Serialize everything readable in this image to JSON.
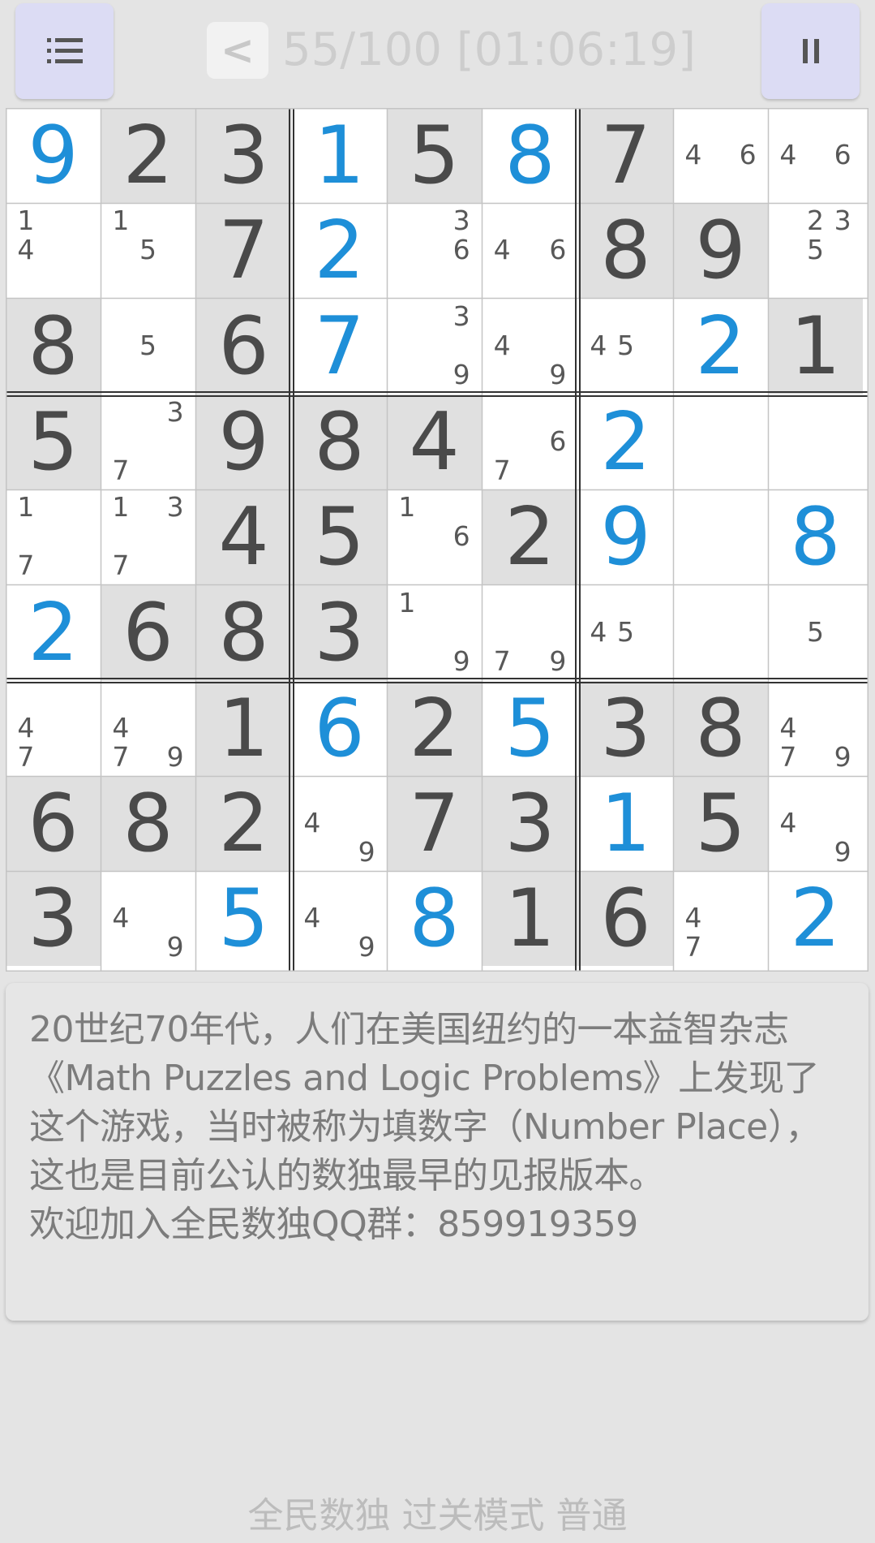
{
  "header": {
    "progress": "55/100",
    "timer": "[01:06:19]",
    "back_label": "<",
    "menu_icon": "menu-icon",
    "pause_icon": "pause-icon"
  },
  "board": {
    "rows": [
      [
        {
          "v": "9",
          "t": "filled"
        },
        {
          "v": "2",
          "t": "given"
        },
        {
          "v": "3",
          "t": "given"
        },
        {
          "v": "1",
          "t": "filled"
        },
        {
          "v": "5",
          "t": "given"
        },
        {
          "v": "8",
          "t": "filled"
        },
        {
          "v": "7",
          "t": "given"
        },
        {
          "v": "",
          "t": "empty",
          "n": [
            4,
            6
          ]
        },
        {
          "v": "",
          "t": "empty",
          "n": [
            4,
            6
          ]
        }
      ],
      [
        {
          "v": "",
          "t": "empty",
          "n": [
            1,
            4
          ]
        },
        {
          "v": "",
          "t": "empty",
          "n": [
            1,
            5
          ]
        },
        {
          "v": "7",
          "t": "given"
        },
        {
          "v": "2",
          "t": "filled"
        },
        {
          "v": "",
          "t": "empty",
          "n": [
            3,
            6
          ]
        },
        {
          "v": "",
          "t": "empty",
          "n": [
            4,
            6
          ]
        },
        {
          "v": "8",
          "t": "given"
        },
        {
          "v": "9",
          "t": "given"
        },
        {
          "v": "",
          "t": "empty",
          "n": [
            2,
            3,
            5
          ]
        }
      ],
      [
        {
          "v": "8",
          "t": "given"
        },
        {
          "v": "",
          "t": "empty",
          "n": [
            5
          ]
        },
        {
          "v": "6",
          "t": "given"
        },
        {
          "v": "7",
          "t": "filled"
        },
        {
          "v": "",
          "t": "empty",
          "n": [
            3,
            9
          ]
        },
        {
          "v": "",
          "t": "empty",
          "n": [
            4,
            9
          ]
        },
        {
          "v": "",
          "t": "empty",
          "n": [
            4,
            5
          ]
        },
        {
          "v": "2",
          "t": "filled"
        },
        {
          "v": "1",
          "t": "given"
        }
      ],
      [
        {
          "v": "5",
          "t": "given"
        },
        {
          "v": "",
          "t": "empty",
          "n": [
            3,
            7
          ]
        },
        {
          "v": "9",
          "t": "given"
        },
        {
          "v": "8",
          "t": "given"
        },
        {
          "v": "4",
          "t": "given"
        },
        {
          "v": "",
          "t": "empty",
          "n": [
            6,
            7
          ]
        },
        {
          "v": "2",
          "t": "filled"
        },
        {
          "v": "",
          "t": "empty",
          "n": []
        },
        {
          "v": "",
          "t": "empty",
          "n": []
        }
      ],
      [
        {
          "v": "",
          "t": "empty",
          "n": [
            1,
            7
          ]
        },
        {
          "v": "",
          "t": "empty",
          "n": [
            1,
            3,
            7
          ]
        },
        {
          "v": "4",
          "t": "given"
        },
        {
          "v": "5",
          "t": "given"
        },
        {
          "v": "",
          "t": "empty",
          "n": [
            1,
            6
          ]
        },
        {
          "v": "2",
          "t": "given"
        },
        {
          "v": "9",
          "t": "filled"
        },
        {
          "v": "",
          "t": "empty",
          "n": []
        },
        {
          "v": "8",
          "t": "filled"
        }
      ],
      [
        {
          "v": "2",
          "t": "filled"
        },
        {
          "v": "6",
          "t": "given"
        },
        {
          "v": "8",
          "t": "given"
        },
        {
          "v": "3",
          "t": "given"
        },
        {
          "v": "",
          "t": "empty",
          "n": [
            1,
            9
          ]
        },
        {
          "v": "",
          "t": "empty",
          "n": [
            7,
            9
          ]
        },
        {
          "v": "",
          "t": "empty",
          "n": [
            4,
            5
          ]
        },
        {
          "v": "",
          "t": "empty",
          "n": []
        },
        {
          "v": "",
          "t": "empty",
          "n": [
            5
          ]
        }
      ],
      [
        {
          "v": "",
          "t": "empty",
          "n": [
            4,
            7
          ]
        },
        {
          "v": "",
          "t": "empty",
          "n": [
            4,
            7,
            9
          ]
        },
        {
          "v": "1",
          "t": "given"
        },
        {
          "v": "6",
          "t": "filled"
        },
        {
          "v": "2",
          "t": "given"
        },
        {
          "v": "5",
          "t": "filled"
        },
        {
          "v": "3",
          "t": "given"
        },
        {
          "v": "8",
          "t": "given"
        },
        {
          "v": "",
          "t": "empty",
          "n": [
            4,
            7,
            9
          ]
        }
      ],
      [
        {
          "v": "6",
          "t": "given"
        },
        {
          "v": "8",
          "t": "given"
        },
        {
          "v": "2",
          "t": "given"
        },
        {
          "v": "",
          "t": "empty",
          "n": [
            4,
            9
          ]
        },
        {
          "v": "7",
          "t": "given"
        },
        {
          "v": "3",
          "t": "given"
        },
        {
          "v": "1",
          "t": "filled"
        },
        {
          "v": "5",
          "t": "given"
        },
        {
          "v": "",
          "t": "empty",
          "n": [
            4,
            9
          ]
        }
      ],
      [
        {
          "v": "3",
          "t": "given"
        },
        {
          "v": "",
          "t": "empty",
          "n": [
            4,
            9
          ]
        },
        {
          "v": "5",
          "t": "filled"
        },
        {
          "v": "",
          "t": "empty",
          "n": [
            4,
            9
          ]
        },
        {
          "v": "8",
          "t": "filled"
        },
        {
          "v": "1",
          "t": "given"
        },
        {
          "v": "6",
          "t": "given"
        },
        {
          "v": "",
          "t": "empty",
          "n": [
            4,
            7
          ]
        },
        {
          "v": "2",
          "t": "filled"
        }
      ]
    ]
  },
  "info": {
    "paragraph": "20世纪70年代，人们在美国纽约的一本益智杂志《Math Puzzles and Logic Problems》上发现了这个游戏，当时被称为填数字（Number Place），这也是目前公认的数独最早的见报版本。",
    "group": "欢迎加入全民数独QQ群：859919359"
  },
  "footer": {
    "text": "全民数独 过关模式 普通"
  },
  "colors": {
    "filled_digit": "#1e8fd8",
    "given_digit": "#4a4a4a",
    "given_bg": "#e0e0e0"
  }
}
